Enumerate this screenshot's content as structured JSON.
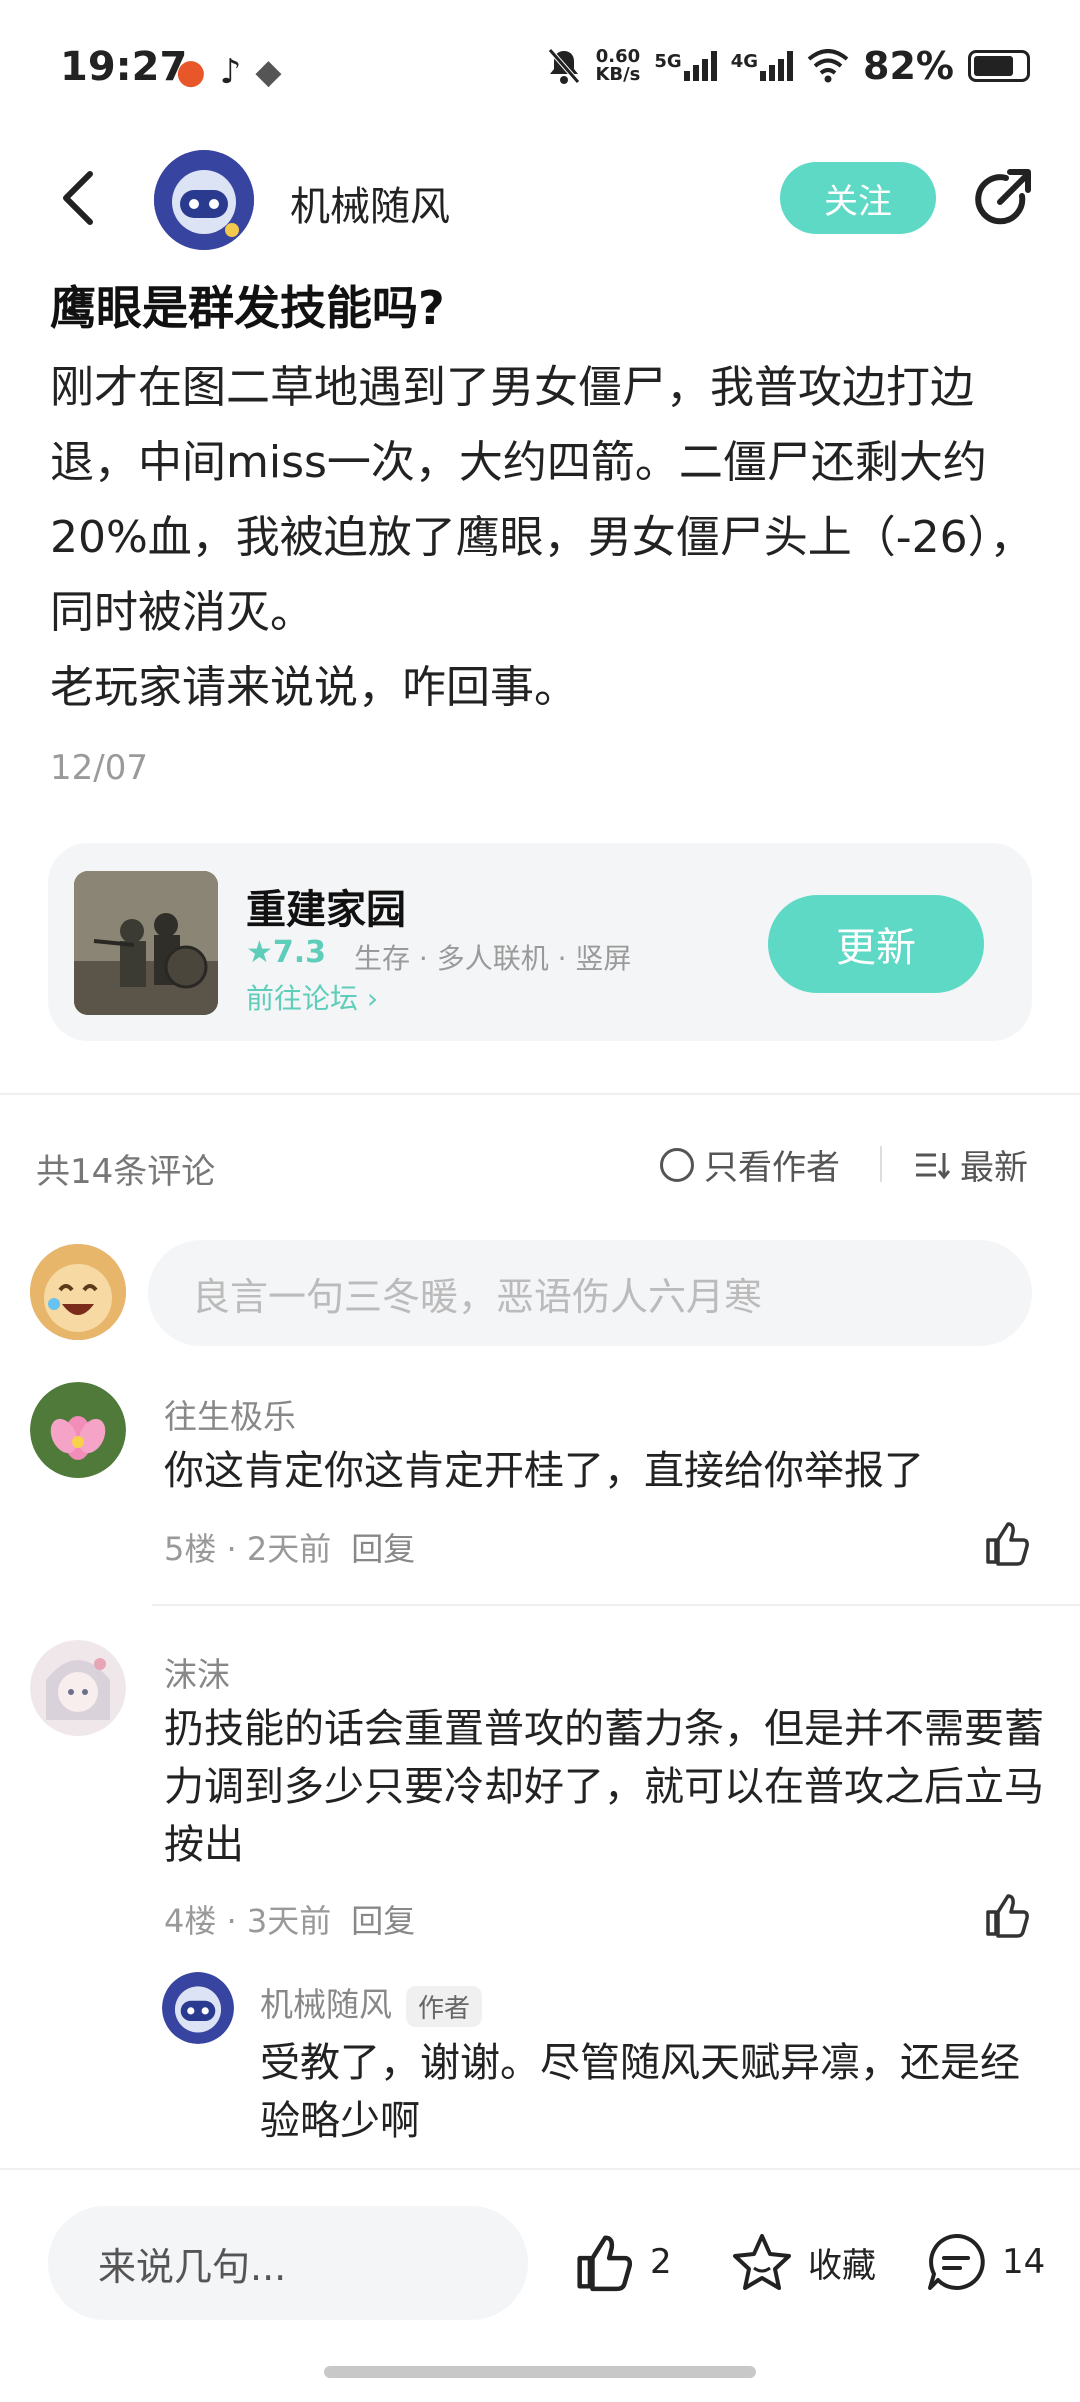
{
  "status_bar": {
    "time": "19:27",
    "net_speed_value": "0.60",
    "net_speed_unit": "KB/s",
    "sig1": "5G",
    "sig2": "4G",
    "battery": "82%"
  },
  "header": {
    "author": "机械随风",
    "follow_label": "关注"
  },
  "post": {
    "title": "鹰眼是群发技能吗?",
    "body": [
      "刚才在图二草地遇到了男女僵尸，我普攻边打边退，中间miss一次，大约四箭。二僵尸还剩大约20%血，我被迫放了鹰眼，男女僵尸头上（-26），同时被消灭。",
      "老玩家请来说说，咋回事。"
    ],
    "date": "12/07"
  },
  "game": {
    "name": "重建家园",
    "rating": "7.3",
    "tags": "生存 · 多人联机 · 竖屏",
    "forum_link": "前往论坛",
    "update_label": "更新"
  },
  "comments_header": {
    "count_label": "共14条评论",
    "only_author_label": "只看作者",
    "sort_label": "最新"
  },
  "comment_input": {
    "placeholder": "良言一句三冬暖，恶语伤人六月寒"
  },
  "comments": [
    {
      "name": "往生极乐",
      "text": "你这肯定你这肯定开桂了，直接给你举报了",
      "floor": "5楼",
      "time": "2天前",
      "reply": "回复"
    },
    {
      "name": "沫沫",
      "text": "扔技能的话会重置普攻的蓄力条，但是并不需要蓄力调到多少只要冷却好了，就可以在普攻之后立马按出",
      "floor": "4楼",
      "time": "3天前",
      "reply": "回复"
    }
  ],
  "reply": {
    "name": "机械随风",
    "badge": "作者",
    "text": "受教了，谢谢。尽管随风天赋异凛，还是经验略少啊"
  },
  "bottom_bar": {
    "input_placeholder": "来说几句...",
    "likes": "2",
    "favorite_label": "收藏",
    "comments": "14"
  }
}
